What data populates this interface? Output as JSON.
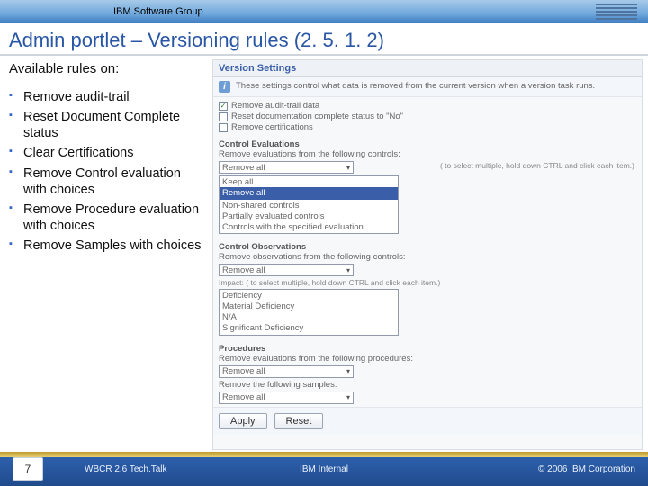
{
  "banner": {
    "group_label": "IBM Software Group",
    "logo_text": "IBM"
  },
  "title": "Admin portlet – Versioning rules (2. 5. 1. 2)",
  "left": {
    "heading": "Available rules on:",
    "items": [
      "Remove audit-trail",
      "Reset Document Complete status",
      "Clear Certifications",
      "Remove Control evaluation with choices",
      "Remove Procedure evaluation with choices",
      "Remove Samples with choices"
    ]
  },
  "shot": {
    "panel_title": "Version Settings",
    "info_text": "These settings control what data is removed from the current version when a version task runs.",
    "checkboxes": [
      {
        "label": "Remove audit-trail data",
        "checked": true
      },
      {
        "label": "Reset documentation complete status to \"No\"",
        "checked": false
      },
      {
        "label": "Remove certifications",
        "checked": false
      }
    ],
    "control_eval": {
      "heading": "Control Evaluations",
      "subhead": "Remove evaluations from the following controls:",
      "select_value": "Remove all",
      "hint": "( to select multiple, hold down CTRL and click each item.)",
      "list": [
        "Keep all",
        "Remove all",
        "Non-shared controls",
        "Partially evaluated controls",
        "Controls with the specified evaluation"
      ]
    },
    "control_obs": {
      "heading": "Control Observations",
      "subhead": "Remove observations from the following controls:",
      "select_value": "Remove all",
      "impact_label": "Impact:  ( to select multiple, hold down CTRL and click each item.)",
      "impact_list": [
        "Deficiency",
        "Material Deficiency",
        "N/A",
        "Significant Deficiency"
      ]
    },
    "procedures": {
      "heading": "Procedures",
      "subhead": "Remove evaluations from the following procedures:",
      "select_value": "Remove all",
      "samples_label": "Remove the following samples:",
      "samples_value": "Remove all"
    },
    "buttons": {
      "apply": "Apply",
      "reset": "Reset"
    }
  },
  "footer": {
    "page_number": "7",
    "left_text": "WBCR 2.6 Tech.Talk",
    "center_text": "IBM Internal",
    "right_text": "© 2006 IBM Corporation"
  }
}
